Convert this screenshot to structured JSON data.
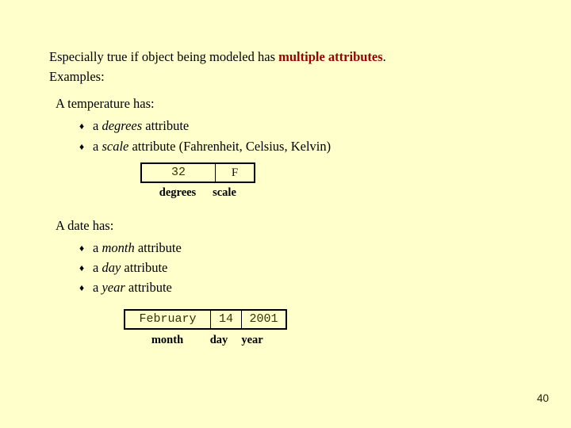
{
  "slide": {
    "background_color": "#ffffcc",
    "page_number": "40",
    "intro": {
      "line1_prefix": "Especially true if object being modeled has ",
      "line1_emphasis": "multiple attributes",
      "line1_suffix": ".",
      "emphasis_color": "#990000",
      "line2": "Examples:"
    },
    "temperature": {
      "heading": "A temperature has:",
      "bullets": [
        {
          "marker": "♦",
          "prefix": "a ",
          "italic": "degrees",
          "suffix": " attribute"
        },
        {
          "marker": "♦",
          "prefix": "a ",
          "italic": "scale",
          "suffix": " attribute  (Fahrenheit, Celsius, Kelvin)"
        }
      ],
      "table": {
        "cells": [
          "32",
          "F"
        ],
        "captions": [
          "degrees",
          "scale"
        ]
      }
    },
    "date": {
      "heading": "A date has:",
      "bullets": [
        {
          "marker": "♦",
          "prefix": "a ",
          "italic": "month",
          "suffix": " attribute"
        },
        {
          "marker": "♦",
          "prefix": "a ",
          "italic": "day",
          "suffix": " attribute"
        },
        {
          "marker": "♦",
          "prefix": "a ",
          "italic": "year",
          "suffix": " attribute"
        }
      ],
      "table": {
        "cells": [
          "February",
          "14",
          "2001"
        ],
        "captions": [
          "month",
          "day",
          "year"
        ]
      }
    }
  }
}
